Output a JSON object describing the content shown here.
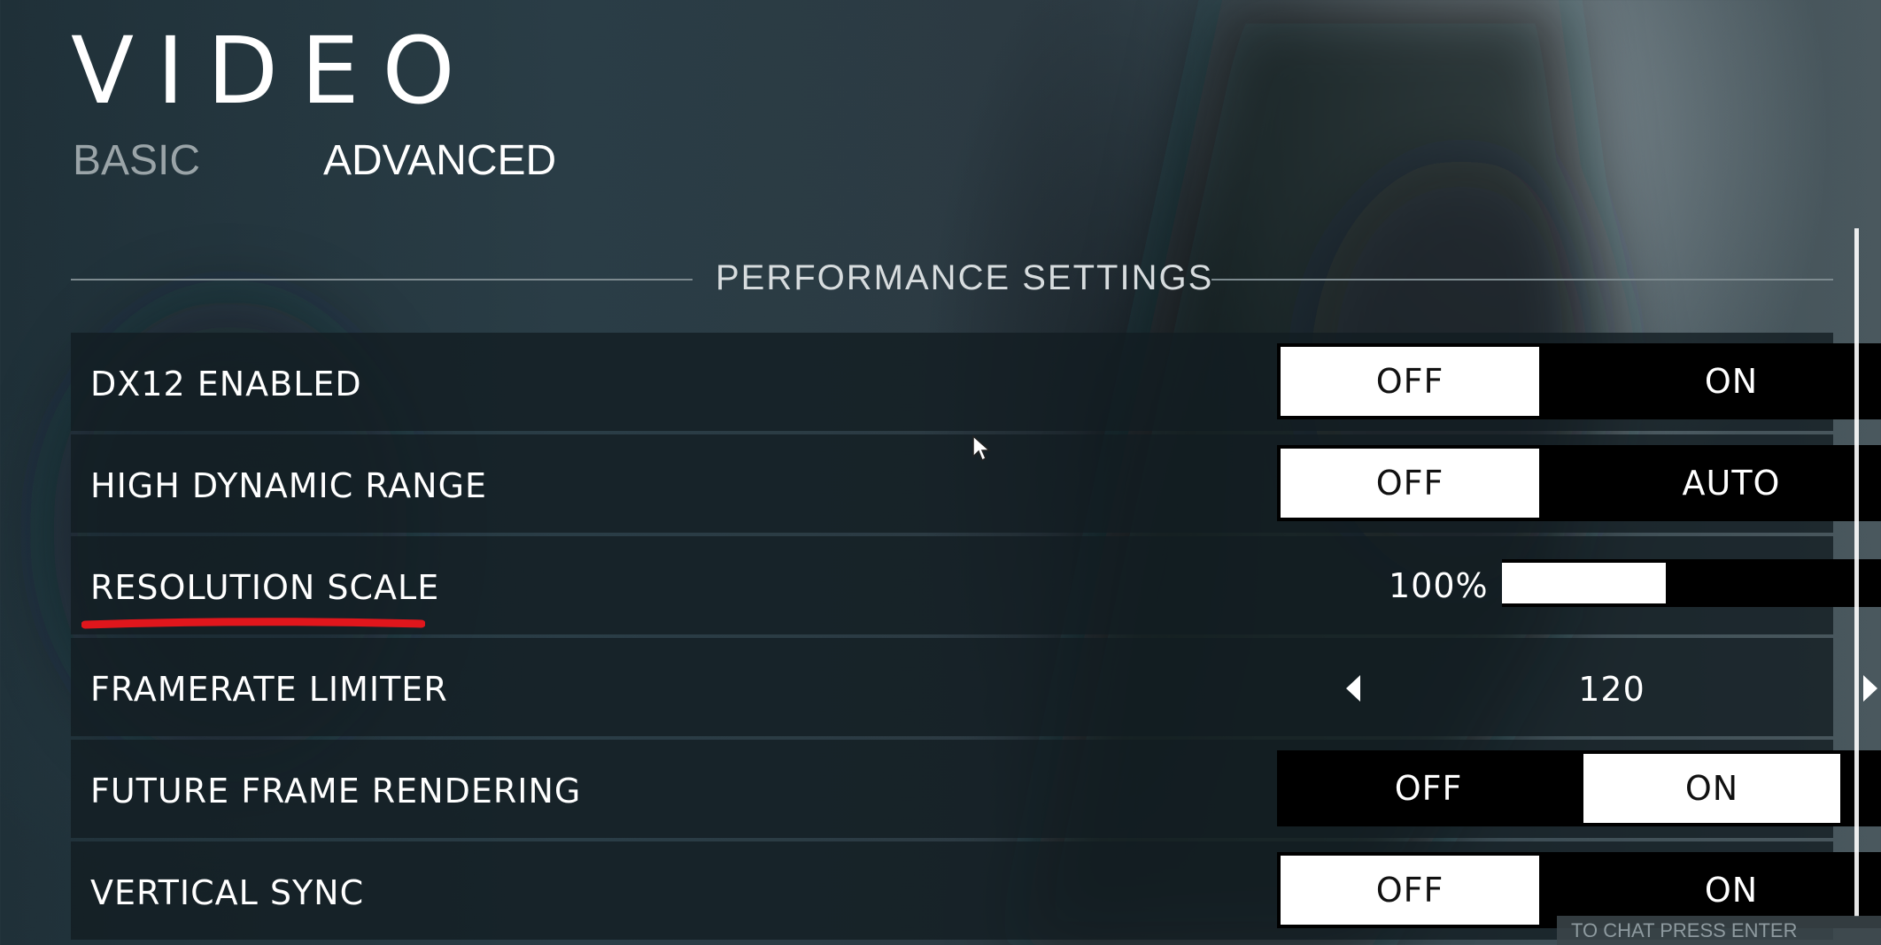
{
  "page": {
    "title": "VIDEO",
    "tabs": [
      {
        "label": "BASIC",
        "active": false
      },
      {
        "label": "ADVANCED",
        "active": true
      }
    ],
    "section_title": "PERFORMANCE SETTINGS"
  },
  "settings": {
    "dx12": {
      "label": "DX12 ENABLED",
      "options": [
        "OFF",
        "ON"
      ],
      "selected": "OFF"
    },
    "hdr": {
      "label": "HIGH DYNAMIC RANGE",
      "options": [
        "OFF",
        "AUTO"
      ],
      "selected": "OFF"
    },
    "resolution_scale": {
      "label": "RESOLUTION SCALE",
      "value": "100%",
      "slider_fraction": 0.43,
      "highlighted_underline_color": "#e0161c"
    },
    "framerate_limiter": {
      "label": "FRAMERATE LIMITER",
      "value": "120",
      "left_icon": "arrow-left-icon",
      "right_icon": "arrow-right-icon"
    },
    "future_frame": {
      "label": "FUTURE FRAME RENDERING",
      "options": [
        "OFF",
        "ON"
      ],
      "selected": "ON"
    },
    "vsync": {
      "label": "VERTICAL SYNC",
      "options": [
        "OFF",
        "ON"
      ],
      "selected": "OFF"
    }
  },
  "chat": {
    "hint": "TO CHAT PRESS ENTER"
  },
  "colors": {
    "selected_bg": "#ffffff",
    "unselected_bg": "#000000",
    "row_bg": "#121c21",
    "underline": "#e0161c"
  }
}
